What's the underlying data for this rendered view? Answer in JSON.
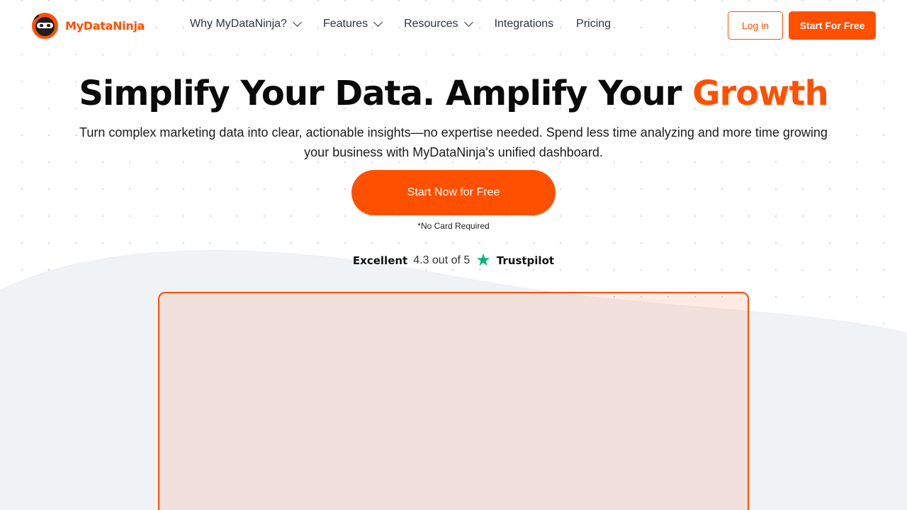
{
  "brand": {
    "name": "MyDataNinja",
    "accent_color": "#ff5000",
    "logo_icon": "ninja-logo-icon"
  },
  "nav": {
    "items": [
      {
        "label": "Why MyDataNinja?",
        "has_dropdown": true
      },
      {
        "label": "Features",
        "has_dropdown": true
      },
      {
        "label": "Resources",
        "has_dropdown": true
      },
      {
        "label": "Integrations",
        "has_dropdown": false
      },
      {
        "label": "Pricing",
        "has_dropdown": false
      }
    ]
  },
  "header": {
    "login_label": "Log in",
    "start_label": "Start For Free"
  },
  "hero": {
    "title_main": "Simplify Your Data. Amplify Your ",
    "title_accent": "Growth",
    "subtitle": "Turn complex marketing data into clear, actionable insights—no expertise needed. Spend less time analyzing and more time growing your business with MyDataNinja's unified dashboard.",
    "cta_label": "Start Now for Free",
    "cta_note": "*No Card Required"
  },
  "trust": {
    "label": "Excellent",
    "rating_text": "4.3 out of 5",
    "icon": "star-icon",
    "icon_color": "#00b67a",
    "brand": "Trustpilot"
  }
}
